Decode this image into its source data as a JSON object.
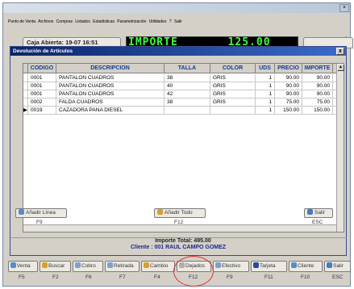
{
  "menu": [
    "Punto de Venta",
    "Archivos",
    "Compras",
    "Listados",
    "Estadísticas",
    "Parametrización",
    "Utilidades",
    "?",
    "Salir"
  ],
  "caja_label": "Caja Abierta: 19-07 16:51",
  "led_display": "IMPORTE       125.00",
  "dialog": {
    "title": "Devolución de Artículos",
    "close": "x",
    "columns": [
      "CODIGO",
      "DESCRIPCION",
      "TALLA",
      "COLOR",
      "UDS",
      "PRECIO",
      "IMPORTE"
    ],
    "rows": [
      {
        "codigo": "0001",
        "descripcion": "PANTALON CUADROS",
        "talla": "38",
        "color": "GRIS",
        "uds": "1",
        "precio": "90.00",
        "importe": "90.00"
      },
      {
        "codigo": "0001",
        "descripcion": "PANTALON CUADROS",
        "talla": "40",
        "color": "GRIS",
        "uds": "1",
        "precio": "90.00",
        "importe": "90.00"
      },
      {
        "codigo": "0001",
        "descripcion": "PANTALON CUADROS",
        "talla": "42",
        "color": "GRIS",
        "uds": "1",
        "precio": "90.00",
        "importe": "90.00"
      },
      {
        "codigo": "0002",
        "descripcion": "FALDA CUADROS",
        "talla": "38",
        "color": "GRIS",
        "uds": "1",
        "precio": "75.00",
        "importe": "75.00"
      },
      {
        "codigo": "0019",
        "descripcion": "CAZADORA PANA DIESEL",
        "talla": "",
        "color": "",
        "uds": "1",
        "precio": "150.00",
        "importe": "150.00"
      }
    ],
    "total": "Importe Total: 495.00",
    "btn_add_line": "Añadir Línea",
    "btn_add_line_key": "F9",
    "btn_add_all": "Añadir Todo",
    "btn_add_all_key": "F12",
    "btn_exit": "Salir",
    "btn_exit_key": "ESC"
  },
  "cliente": "Cliente : 001  RAUL CAMPO GOMEZ",
  "toolbar": [
    {
      "label": "Venta",
      "key": "F5",
      "icon": "sale-icon"
    },
    {
      "label": "Buscar",
      "key": "F2",
      "icon": "search-icon"
    },
    {
      "label": "Cobro",
      "key": "F6",
      "icon": "payment-icon"
    },
    {
      "label": "Retirada",
      "key": "F7",
      "icon": "withdraw-icon"
    },
    {
      "label": "Cambio",
      "key": "F4",
      "icon": "exchange-icon"
    },
    {
      "label": "Dejados",
      "key": "F12",
      "icon": "left-items-icon"
    },
    {
      "label": "Efectivo",
      "key": "F9",
      "icon": "cash-icon"
    },
    {
      "label": "Tarjeta",
      "key": "F11",
      "icon": "card-icon"
    },
    {
      "label": "Cliente",
      "key": "F10",
      "icon": "customer-icon"
    },
    {
      "label": "Salir",
      "key": "ESC",
      "icon": "exit-icon"
    }
  ],
  "colors": {
    "led_text": "#3cff3c",
    "dialog_title": "#0a246a",
    "highlight_circle": "#e03030",
    "header_text": "#123a9a"
  }
}
